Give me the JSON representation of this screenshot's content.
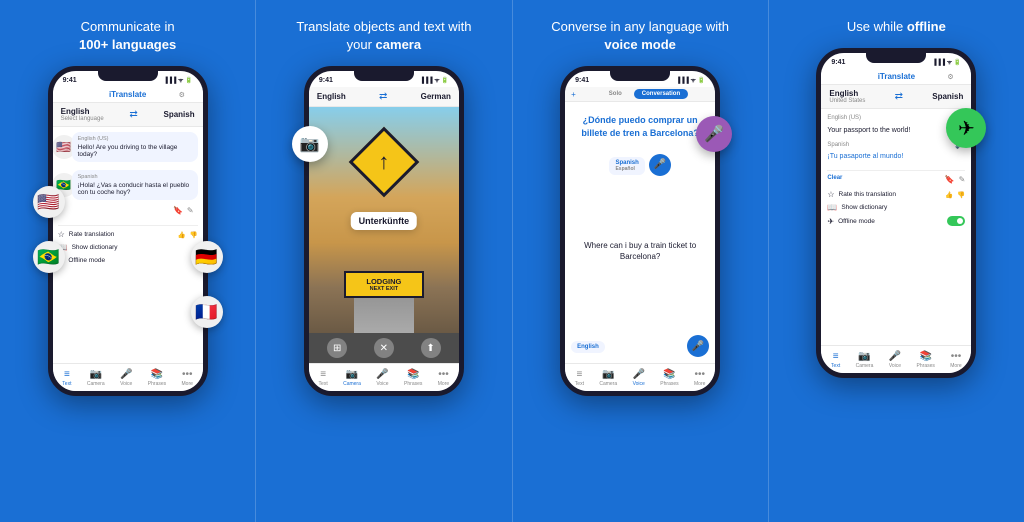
{
  "panels": [
    {
      "id": "panel-1",
      "title": "Communicate in ",
      "title_bold": "100+ languages",
      "phone": {
        "status_time": "9:41",
        "app_title": "iTranslate",
        "lang_from": "English",
        "lang_from_sub": "Select language",
        "lang_to": "Spanish",
        "chat": [
          {
            "label": "English (US)",
            "text": "Hello! Are you driving to the village today?",
            "flag": "🇺🇸",
            "side": "left"
          },
          {
            "label": "Spanish",
            "text": "¡Hola! ¿Vas a conducir hasta el pueblo con tu coche hoy?",
            "flag": "🇧🇷",
            "side": "left"
          }
        ],
        "options": [
          {
            "icon": "☆",
            "label": "Rate translation"
          },
          {
            "icon": "📖",
            "label": "Show dictionary"
          },
          {
            "icon": "✈",
            "label": "Offline mode"
          }
        ],
        "nav": [
          "Text",
          "Camera",
          "Voice",
          "Phrases",
          "More"
        ]
      }
    },
    {
      "id": "panel-2",
      "title": "Translate objects and text with your ",
      "title_bold": "camera",
      "phone": {
        "status_time": "9:41",
        "lang_from": "English",
        "lang_to": "German",
        "overlay_text": "Unterkünfte",
        "lodging_text": "LODGING",
        "lodging_sub": "NEXT EXIT",
        "nav": [
          "Text",
          "Camera",
          "Voice",
          "Phrases",
          "More"
        ]
      }
    },
    {
      "id": "panel-3",
      "title": "Converse in any language with ",
      "title_bold": "voice mode",
      "phone": {
        "status_time": "9:41",
        "tabs": [
          "Solo",
          "Conversation"
        ],
        "active_tab": "Conversation",
        "question_es": "¿Dónde puedo comprar un billete de tren a Barcelona?",
        "answer_en": "Where can i buy a train ticket to Barcelona?",
        "lang_badge": "Spanish",
        "lang_badge_sub": "Español",
        "lang_bottom": "English",
        "nav": [
          "Text",
          "Camera",
          "Voice",
          "Phrases",
          "More"
        ]
      }
    },
    {
      "id": "panel-4",
      "title": "Use while ",
      "title_bold": "offline",
      "phone": {
        "status_time": "9:41",
        "app_title": "iTranslate",
        "lang_from": "English",
        "lang_from_sub": "United States",
        "lang_to": "Spanish",
        "translation_src": "Your passport to the world!",
        "translation_dst": "¡Tu pasaporte al mundo!",
        "translation_src_label": "English (US)",
        "translation_dst_label": "Spanish",
        "options": [
          {
            "icon": "☆",
            "label": "Rate this translation",
            "toggle": false
          },
          {
            "icon": "📖",
            "label": "Show dictionary",
            "toggle": false
          },
          {
            "icon": "✈",
            "label": "Offline mode",
            "toggle": true
          }
        ],
        "clear_label": "Clear",
        "nav": [
          "Text",
          "Camera",
          "Voice",
          "Phrases",
          "More"
        ]
      }
    }
  ]
}
